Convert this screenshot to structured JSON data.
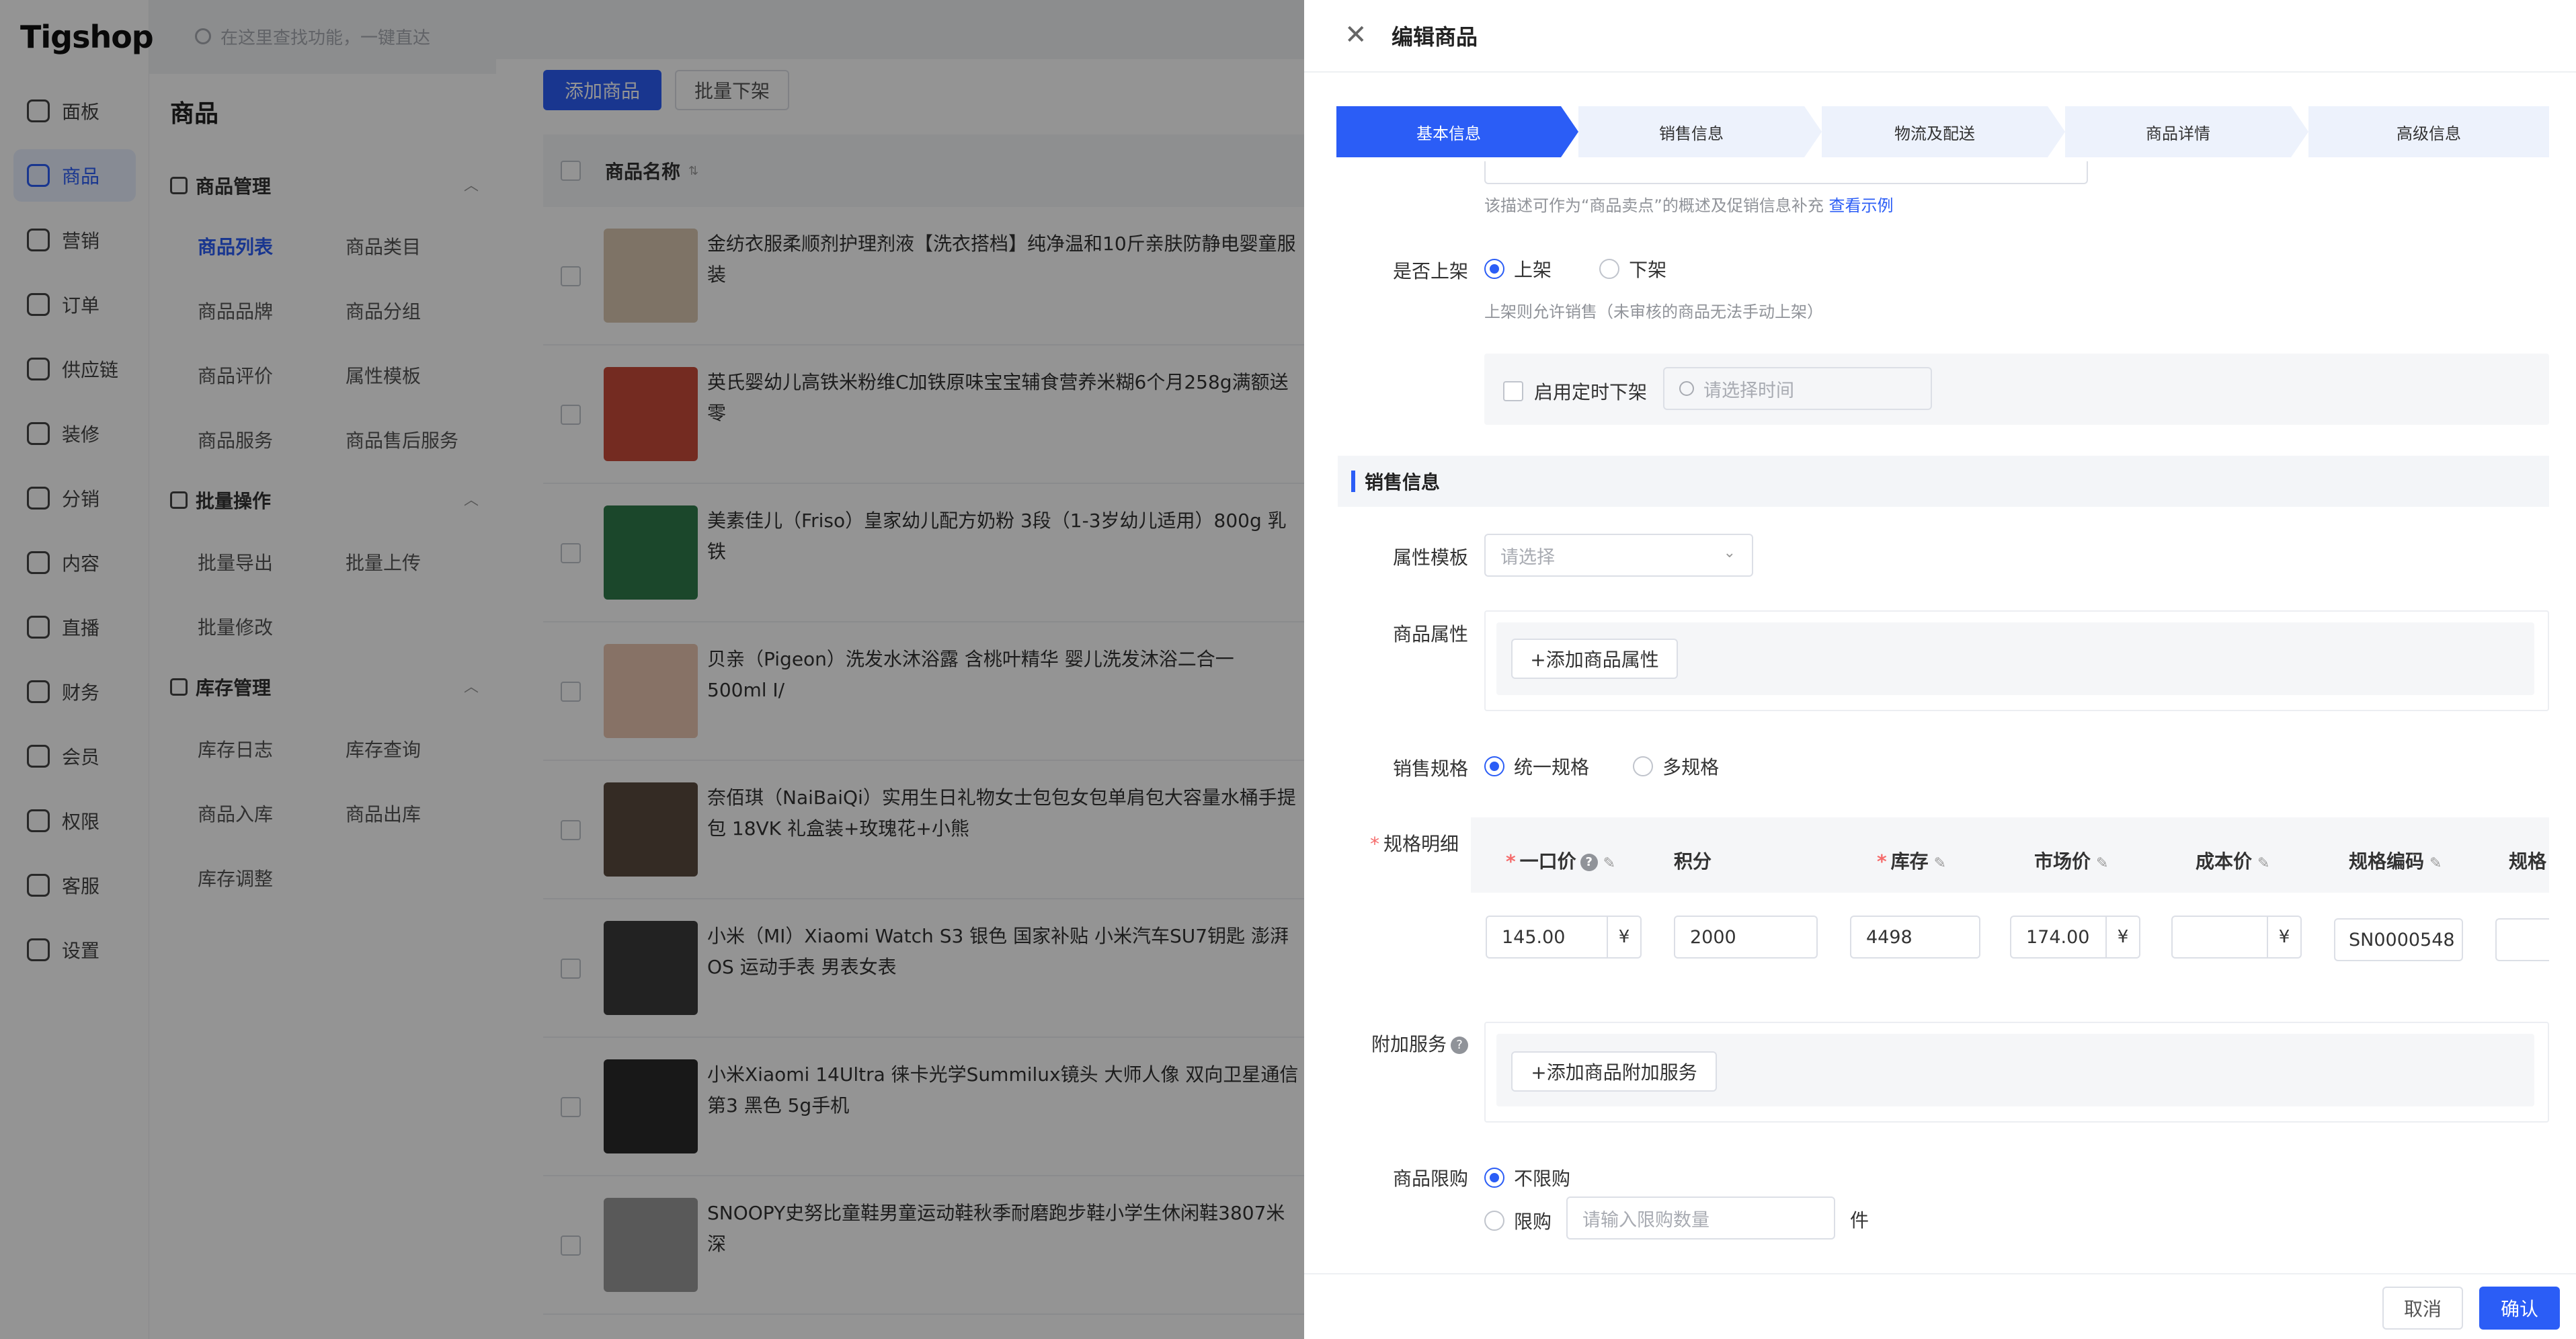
{
  "app": {
    "logo": "Tigshop",
    "search_placeholder": "在这里查找功能，一键直达"
  },
  "rail": [
    {
      "label": "面板",
      "icon": "dashboard-icon"
    },
    {
      "label": "商品",
      "icon": "box-icon",
      "active": true
    },
    {
      "label": "营销",
      "icon": "marketing-icon"
    },
    {
      "label": "订单",
      "icon": "order-icon"
    },
    {
      "label": "供应链",
      "icon": "supply-chain-icon"
    },
    {
      "label": "装修",
      "icon": "decoration-icon"
    },
    {
      "label": "分销",
      "icon": "distribution-icon"
    },
    {
      "label": "内容",
      "icon": "content-icon"
    },
    {
      "label": "直播",
      "icon": "live-icon"
    },
    {
      "label": "财务",
      "icon": "finance-icon"
    },
    {
      "label": "会员",
      "icon": "member-icon"
    },
    {
      "label": "权限",
      "icon": "permission-icon"
    },
    {
      "label": "客服",
      "icon": "service-icon"
    },
    {
      "label": "设置",
      "icon": "settings-icon"
    }
  ],
  "subnav": {
    "title": "商品",
    "groups": [
      {
        "title": "商品管理",
        "items": [
          "商品列表",
          "商品类目",
          "商品品牌",
          "商品分组",
          "商品评价",
          "属性模板",
          "商品服务",
          "商品售后服务"
        ]
      },
      {
        "title": "批量操作",
        "items": [
          "批量导出",
          "批量上传",
          "批量修改"
        ]
      },
      {
        "title": "库存管理",
        "items": [
          "库存日志",
          "库存查询",
          "商品入库",
          "商品出库",
          "库存调整"
        ]
      }
    ]
  },
  "list": {
    "add_button": "添加商品",
    "batch_button": "批量下架",
    "col_name": "商品名称",
    "rows": [
      {
        "name": "金纺衣服柔顺剂护理剂液【洗衣搭档】纯净温和10斤亲肤防静电婴童服装"
      },
      {
        "name": "英氏婴幼儿高铁米粉维C加铁原味宝宝辅食营养米糊6个月258g满额送零"
      },
      {
        "name": "美素佳儿（Friso）皇家幼儿配方奶粉 3段（1-3岁幼儿适用）800g 乳铁"
      },
      {
        "name": "贝亲（Pigeon）洗发水沐浴露 含桃叶精华 婴儿洗发沐浴二合一 500ml I/"
      },
      {
        "name": "奈佰琪（NaiBaiQi）实用生日礼物女士包包女包单肩包大容量水桶手提包 18VK 礼盒装+玫瑰花+小熊"
      },
      {
        "name": "小米（MI）Xiaomi Watch S3 银色 国家补贴 小米汽车SU7钥匙 澎湃OS 运动手表 男表女表"
      },
      {
        "name": "小米Xiaomi 14Ultra 徕卡光学Summilux镜头 大师人像 双向卫星通信 第3 黑色 5g手机"
      },
      {
        "name": "SNOOPY史努比童鞋男童运动鞋秋季耐磨跑步鞋小学生休闲鞋3807米深"
      }
    ]
  },
  "drawer": {
    "title": "编辑商品",
    "steps": [
      "基本信息",
      "销售信息",
      "物流及配送",
      "商品详情",
      "高级信息"
    ],
    "desc_hint": "该描述可作为“商品卖点”的概述及促销信息补充",
    "desc_link": "查看示例",
    "on_shelf": {
      "label": "是否上架",
      "opt_on": "上架",
      "opt_off": "下架",
      "hint": "上架则允许销售（未审核的商品无法手动上架）",
      "timer_label": "启用定时下架",
      "timer_placeholder": "请选择时间"
    },
    "sales_section": "销售信息",
    "attr_template": {
      "label": "属性模板",
      "placeholder": "请选择"
    },
    "attrs": {
      "label": "商品属性",
      "button": "+添加商品属性"
    },
    "spec": {
      "label": "销售规格",
      "opt_single": "统一规格",
      "opt_multi": "多规格"
    },
    "spec_detail": {
      "label": "规格明细",
      "cols": [
        "一口价",
        "积分",
        "库存",
        "市场价",
        "成本价",
        "规格编码",
        "规格"
      ],
      "price": "145.00",
      "points": "2000",
      "stock": "4498",
      "market_price": "174.00",
      "cost_price": "",
      "sku": "SN0000548",
      "currency": "¥"
    },
    "extra": {
      "label": "附加服务",
      "button": "+添加商品附加服务"
    },
    "limit": {
      "label": "商品限购",
      "opt_unlimited": "不限购",
      "opt_limit": "限购",
      "placeholder": "请输入限购数量",
      "unit": "件"
    },
    "cancel": "取消",
    "confirm": "确认"
  }
}
